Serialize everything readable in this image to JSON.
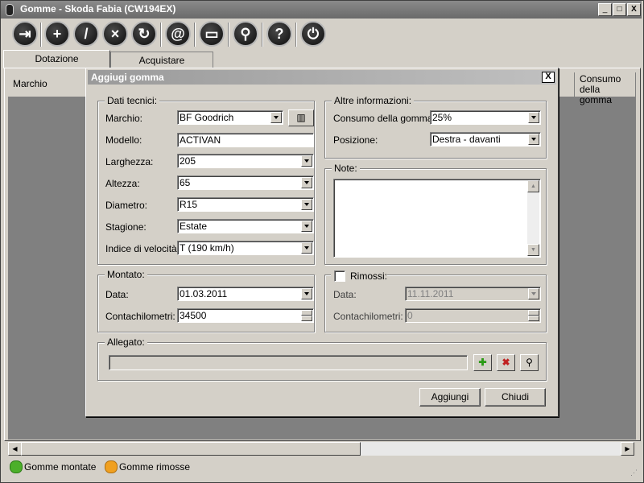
{
  "window": {
    "title": "Gomme - Skoda Fabia (CW194EX)",
    "minimize": "_",
    "maximize": "□",
    "close": "X"
  },
  "toolbar": {
    "icons": [
      "exit-icon",
      "add-icon",
      "edit-icon",
      "delete-icon",
      "refresh-icon",
      "email-icon",
      "print-icon",
      "search-icon",
      "help-icon",
      "info-icon"
    ]
  },
  "tabs": [
    "Dotazione",
    "Acquistare"
  ],
  "grid": {
    "columns": [
      "Marchio",
      "Consumo della gomma"
    ]
  },
  "statusbar": {
    "mounted_label": "Gomme montate",
    "removed_label": "Gomme rimosse",
    "mounted_color": "#4caf2a",
    "removed_color": "#f0a020"
  },
  "dialog": {
    "title": "Aggiugi gomma",
    "close": "X",
    "tech": {
      "legend": "Dati tecnici:",
      "brand_label": "Marchio:",
      "brand_value": "BF Goodrich",
      "model_label": "Modello:",
      "model_value": "ACTIVAN",
      "width_label": "Larghezza:",
      "width_value": "205",
      "height_label": "Altezza:",
      "height_value": "65",
      "diameter_label": "Diametro:",
      "diameter_value": "R15",
      "season_label": "Stagione:",
      "season_value": "Estate",
      "speed_label": "Indice di velocità:",
      "speed_value": "T (190 km/h)"
    },
    "other": {
      "legend": "Altre informazioni:",
      "wear_label": "Consumo della gomma:",
      "wear_value": "25%",
      "position_label": "Posizione:",
      "position_value": "Destra - davanti"
    },
    "notes": {
      "legend": "Note:",
      "value": ""
    },
    "mounted": {
      "legend": "Montato:",
      "date_label": "Data:",
      "date_value": "01.03.2011",
      "km_label": "Contachilometri:",
      "km_value": "34500"
    },
    "removed": {
      "legend": "Rimossi:",
      "checked": false,
      "date_label": "Data:",
      "date_value": "11.11.2011",
      "km_label": "Contachilometri:",
      "km_value": "0"
    },
    "attachment": {
      "legend": "Allegato:",
      "value": ""
    },
    "add_button": "Aggiungi",
    "close_button": "Chiudi"
  }
}
